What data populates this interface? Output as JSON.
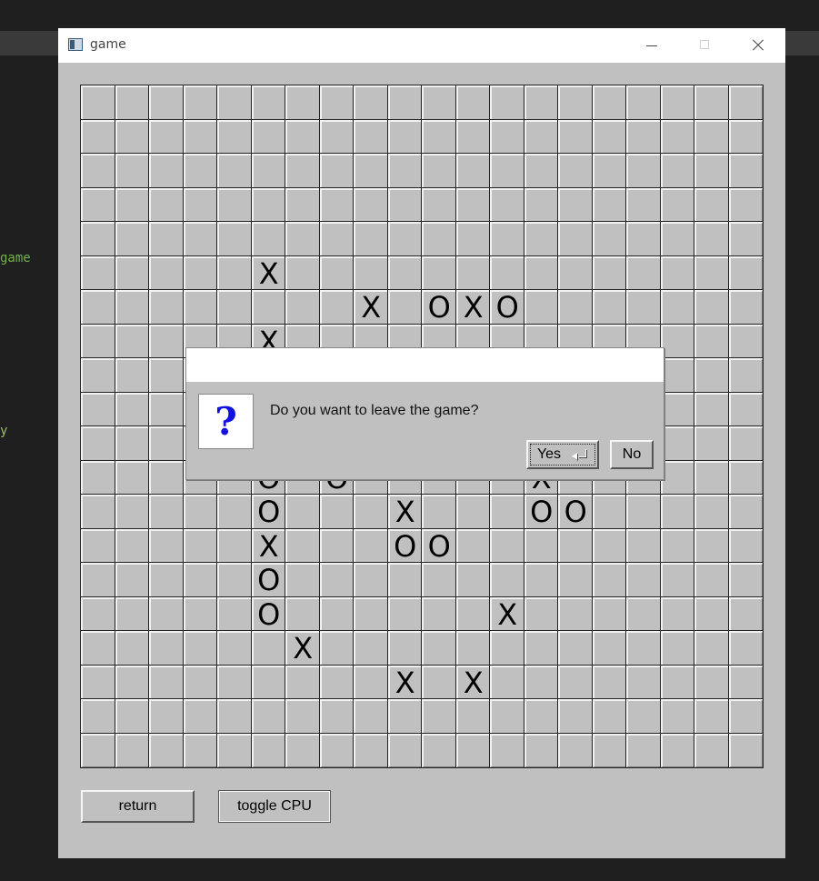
{
  "background": {
    "text_game": "game",
    "text_y": "y"
  },
  "window": {
    "title": "game",
    "icon": "window-app-icon",
    "controls": [
      "minimize-icon",
      "maximize-icon",
      "close-icon"
    ]
  },
  "board": {
    "size": 20,
    "marks": [
      {
        "row": 5,
        "col": 5,
        "mark": "X"
      },
      {
        "row": 6,
        "col": 8,
        "mark": "X"
      },
      {
        "row": 6,
        "col": 10,
        "mark": "O"
      },
      {
        "row": 6,
        "col": 11,
        "mark": "X"
      },
      {
        "row": 6,
        "col": 12,
        "mark": "O"
      },
      {
        "row": 7,
        "col": 5,
        "mark": "X"
      },
      {
        "row": 11,
        "col": 5,
        "mark": "O"
      },
      {
        "row": 11,
        "col": 7,
        "mark": "O"
      },
      {
        "row": 11,
        "col": 13,
        "mark": "X"
      },
      {
        "row": 12,
        "col": 5,
        "mark": "O"
      },
      {
        "row": 12,
        "col": 9,
        "mark": "X"
      },
      {
        "row": 12,
        "col": 13,
        "mark": "O"
      },
      {
        "row": 12,
        "col": 14,
        "mark": "O"
      },
      {
        "row": 13,
        "col": 5,
        "mark": "X"
      },
      {
        "row": 13,
        "col": 9,
        "mark": "O"
      },
      {
        "row": 13,
        "col": 10,
        "mark": "O"
      },
      {
        "row": 14,
        "col": 5,
        "mark": "O"
      },
      {
        "row": 15,
        "col": 5,
        "mark": "O"
      },
      {
        "row": 15,
        "col": 12,
        "mark": "X"
      },
      {
        "row": 16,
        "col": 6,
        "mark": "X"
      },
      {
        "row": 17,
        "col": 9,
        "mark": "X"
      },
      {
        "row": 17,
        "col": 11,
        "mark": "X"
      }
    ]
  },
  "buttons": {
    "return_label": "return",
    "toggle_label": "toggle CPU"
  },
  "dialog": {
    "icon_glyph": "?",
    "message": "Do you want to leave the game?",
    "yes_label": "Yes",
    "no_label": "No"
  },
  "colors": {
    "window_bg": "#c0c0c0",
    "question_icon": "#1212e0"
  }
}
